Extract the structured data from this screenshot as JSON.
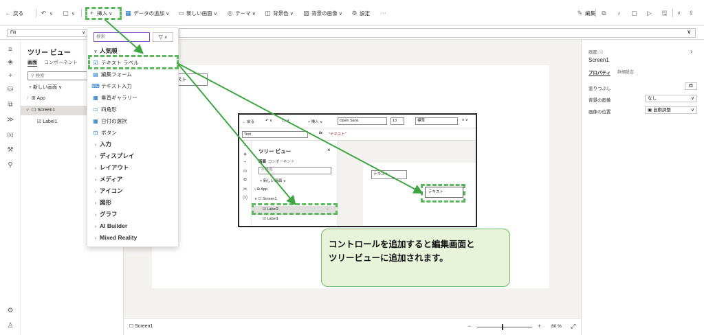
{
  "toolbar": {
    "back": "戻る",
    "insert": "挿入",
    "add_data": "データの追加",
    "new_screen": "新しい画面",
    "theme": "テーマ",
    "bg_color": "背景色",
    "bg_image": "背景の画像",
    "settings": "設定",
    "more": "···",
    "edit": "編集"
  },
  "formula": {
    "property": "Fill"
  },
  "tree": {
    "title": "ツリー ビュー",
    "tab_screens": "画面",
    "tab_components": "コンポーネント",
    "search_placeholder": "検索",
    "new_screen": "新しい画面",
    "app": "App",
    "screen1": "Screen1",
    "label1": "Label1"
  },
  "insert_menu": {
    "search_placeholder": "検索",
    "popular_header": "人気順",
    "items": [
      "テキスト ラベル",
      "編集フォーム",
      "テキスト入力",
      "垂直ギャラリー",
      "四角形",
      "日付の選択",
      "ボタン"
    ],
    "categories": [
      "入力",
      "ディスプレイ",
      "レイアウト",
      "メディア",
      "アイコン",
      "図形",
      "グラフ",
      "AI Builder",
      "Mixed Reality"
    ]
  },
  "canvas": {
    "label_partial": "スト"
  },
  "inset": {
    "toolbar": {
      "back": "戻る",
      "insert": "挿入",
      "font": "Open Sans",
      "size": "13",
      "weight": "標準"
    },
    "formula": {
      "property": "Text",
      "fx": "fx",
      "value": "\"テキスト\""
    },
    "tree": {
      "title": "ツリー ビュー",
      "tab_screens": "画面",
      "tab_components": "コンポーネント",
      "search_placeholder": "検索",
      "new_screen": "新しい画面",
      "app": "App",
      "screen1": "Screen1",
      "label2": "Label2",
      "label1": "Label1",
      "close": "×",
      "more": "···"
    },
    "label_a": "テキスト",
    "label_b": "テキスト"
  },
  "callout": {
    "line1": "コントロールを追加すると編集画面と",
    "line2": "ツリービューに追加されます。"
  },
  "right_panel": {
    "kind": "画面",
    "name": "Screen1",
    "tab_properties": "プロパティ",
    "tab_advanced": "詳細設定",
    "fill_label": "塗りつぶし",
    "bg_image_label": "背景の画像",
    "bg_image_value": "なし",
    "image_pos_label": "画像の位置",
    "image_pos_value": "自動調整"
  },
  "status": {
    "screen": "Screen1",
    "zoom": "80 %",
    "minus": "−",
    "plus": "+"
  },
  "colors": {
    "accent": "#0f6cbd",
    "highlight_dash": "#5cb85c",
    "callout_bg": "#e8f3da"
  }
}
